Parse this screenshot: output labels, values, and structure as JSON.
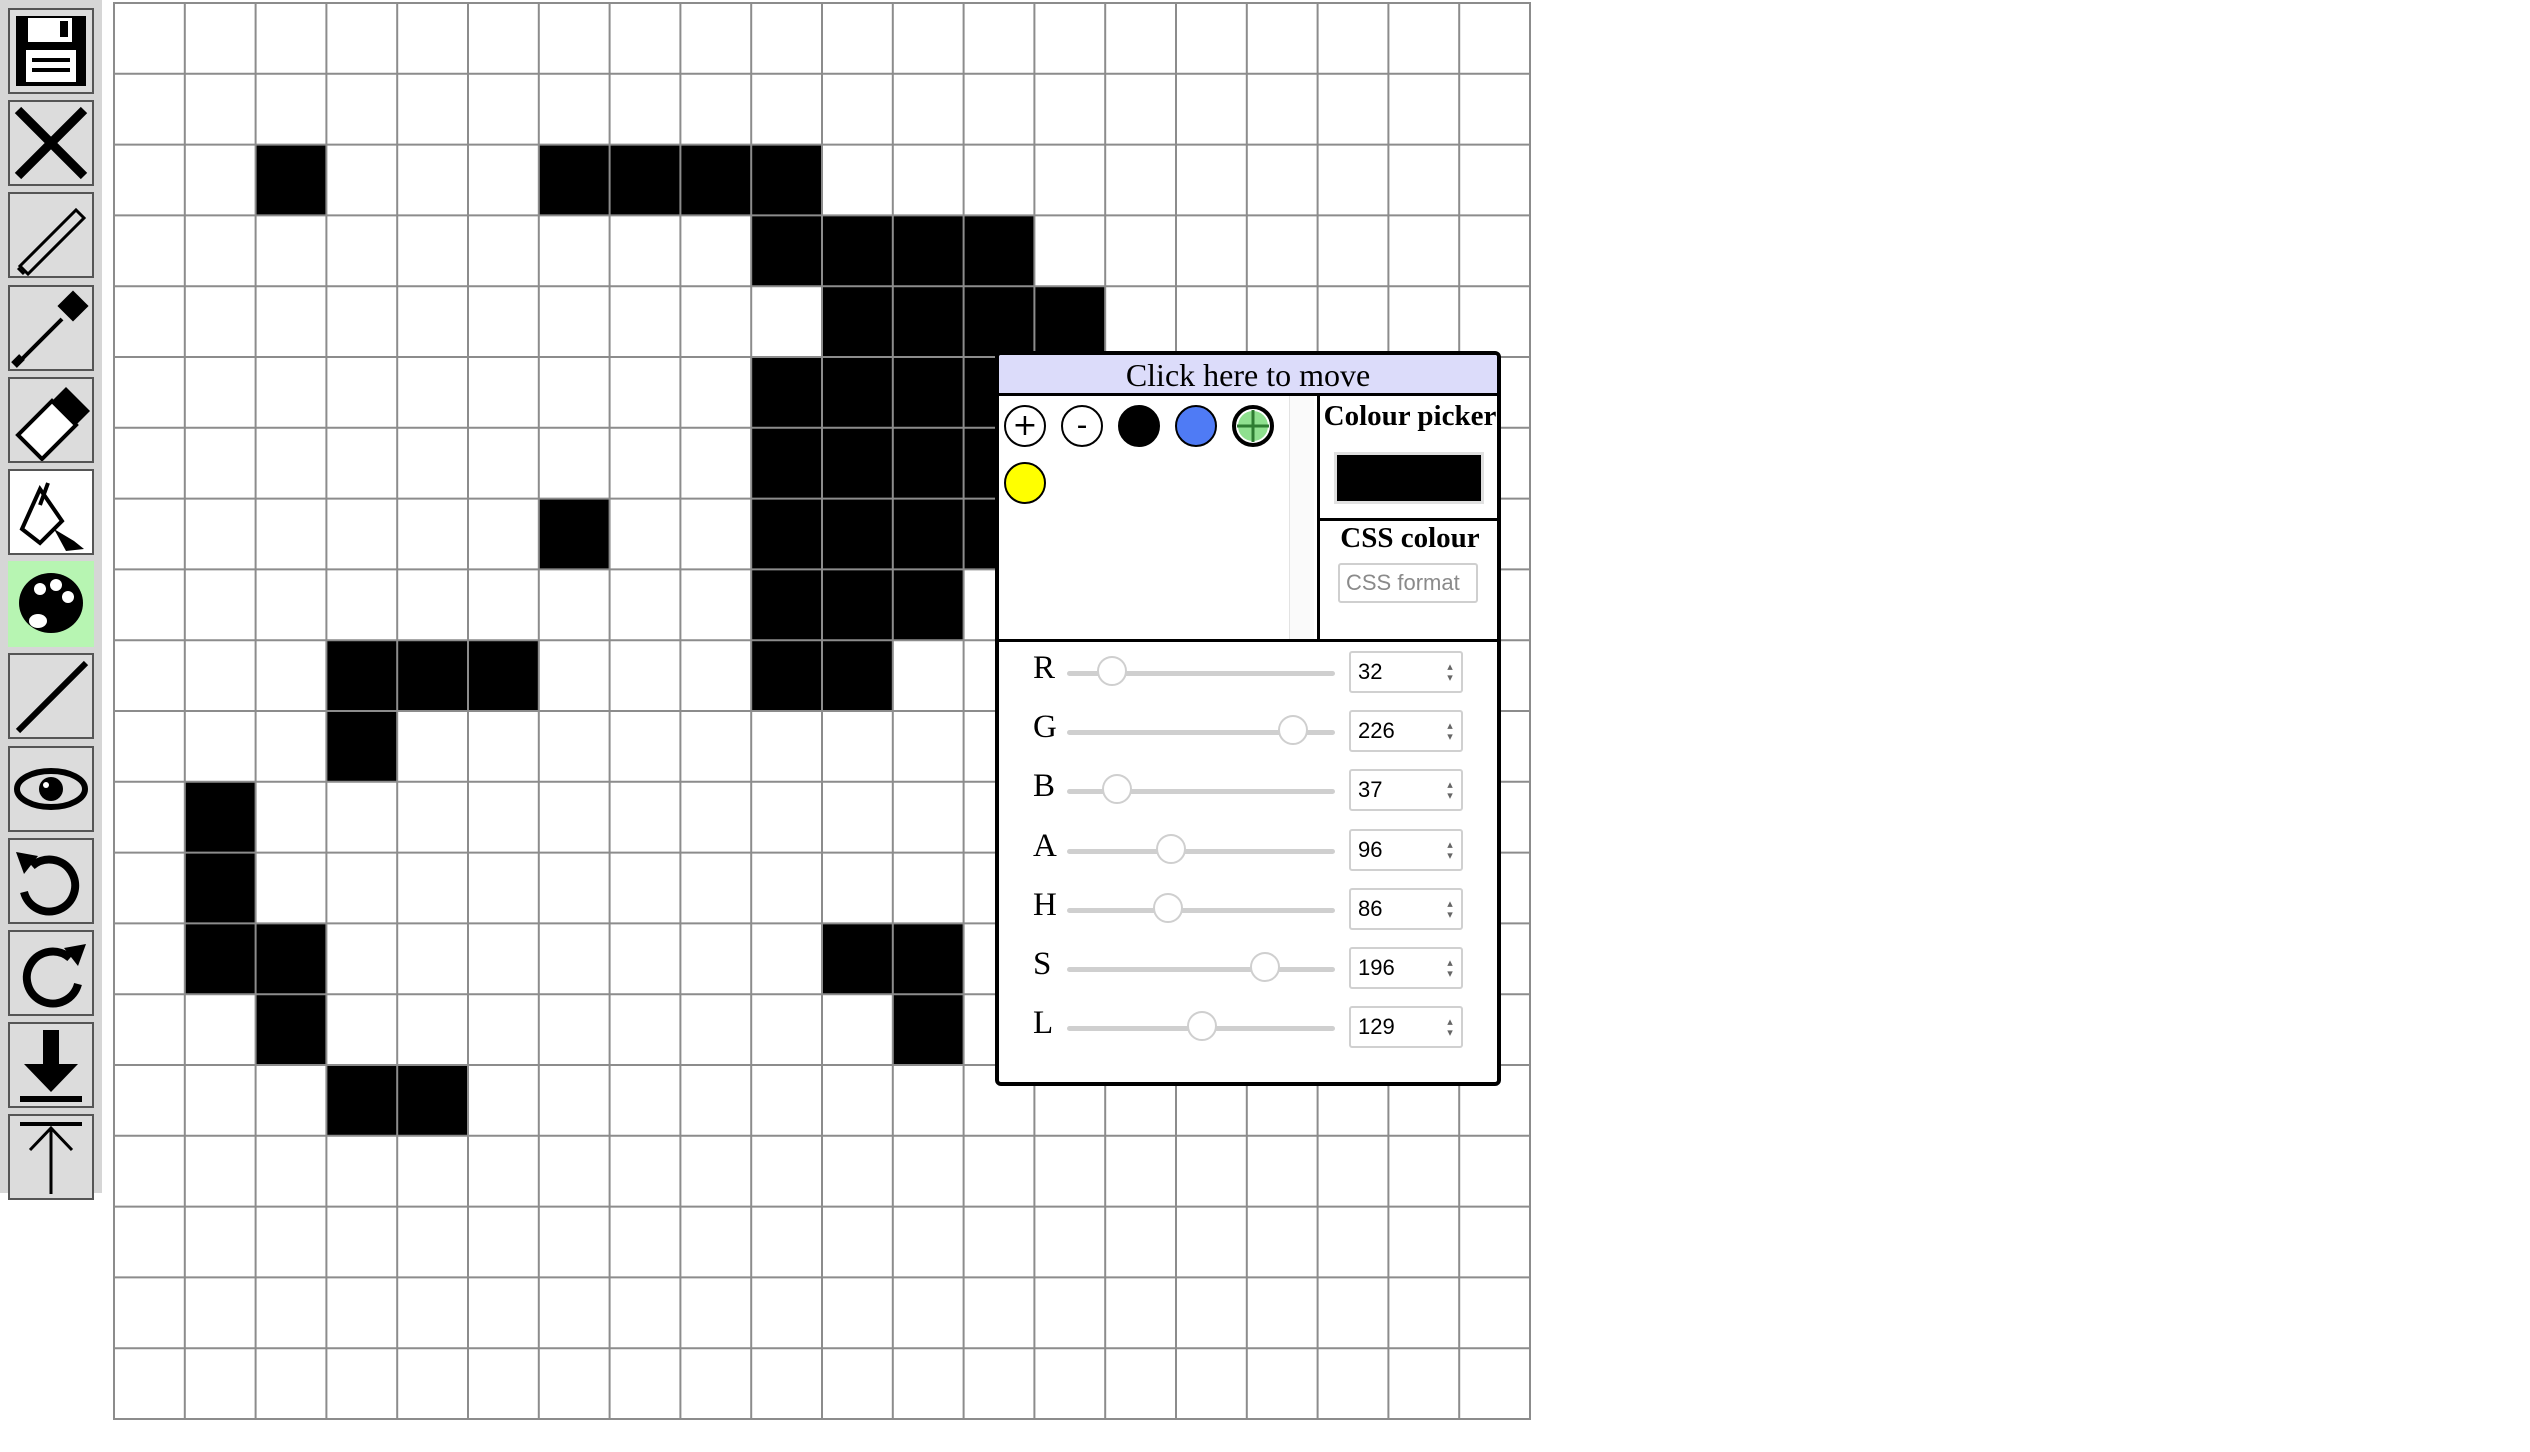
{
  "toolbar": {
    "tools": [
      {
        "name": "save-icon",
        "active": false
      },
      {
        "name": "clear-icon",
        "active": false
      },
      {
        "name": "pencil-icon",
        "active": false
      },
      {
        "name": "eyedropper-icon",
        "active": false
      },
      {
        "name": "eraser-icon",
        "active": false
      },
      {
        "name": "fill-bucket-icon",
        "active": false
      },
      {
        "name": "palette-icon",
        "active": true
      },
      {
        "name": "line-icon",
        "active": false
      },
      {
        "name": "preview-eye-icon",
        "active": false
      },
      {
        "name": "undo-icon",
        "active": false
      },
      {
        "name": "redo-icon",
        "active": false
      },
      {
        "name": "download-icon",
        "active": false
      },
      {
        "name": "upload-icon",
        "active": false
      }
    ]
  },
  "canvas": {
    "columns": 20,
    "rows": 20,
    "filled_cells": [
      [
        2,
        2
      ],
      [
        2,
        6
      ],
      [
        2,
        7
      ],
      [
        2,
        8
      ],
      [
        2,
        9
      ],
      [
        3,
        9
      ],
      [
        3,
        10
      ],
      [
        3,
        11
      ],
      [
        3,
        12
      ],
      [
        4,
        10
      ],
      [
        4,
        11
      ],
      [
        4,
        12
      ],
      [
        4,
        13
      ],
      [
        5,
        9
      ],
      [
        5,
        10
      ],
      [
        5,
        11
      ],
      [
        5,
        12
      ],
      [
        5,
        13
      ],
      [
        6,
        9
      ],
      [
        6,
        10
      ],
      [
        6,
        11
      ],
      [
        6,
        12
      ],
      [
        6,
        13
      ],
      [
        7,
        6
      ],
      [
        7,
        9
      ],
      [
        7,
        10
      ],
      [
        7,
        11
      ],
      [
        7,
        12
      ],
      [
        8,
        9
      ],
      [
        8,
        10
      ],
      [
        8,
        11
      ],
      [
        9,
        3
      ],
      [
        9,
        4
      ],
      [
        9,
        5
      ],
      [
        9,
        9
      ],
      [
        9,
        10
      ],
      [
        10,
        3
      ],
      [
        11,
        1
      ],
      [
        12,
        1
      ],
      [
        13,
        1
      ],
      [
        13,
        2
      ],
      [
        13,
        10
      ],
      [
        13,
        11
      ],
      [
        14,
        2
      ],
      [
        14,
        11
      ],
      [
        15,
        3
      ],
      [
        15,
        4
      ]
    ],
    "fill_color": "#000000"
  },
  "colour_panel": {
    "title": "Click here to move",
    "swatches": [
      {
        "kind": "add",
        "label": "+"
      },
      {
        "kind": "remove",
        "label": "-"
      },
      {
        "kind": "color",
        "color": "#000000"
      },
      {
        "kind": "color",
        "color": "#4f7bf5"
      },
      {
        "kind": "current",
        "color": "#8fe08f"
      },
      {
        "kind": "color",
        "color": "#ffff00"
      }
    ],
    "picker_label": "Colour picker",
    "picker_color": "#000000",
    "css_label": "CSS colour",
    "css_placeholder": "CSS format",
    "sliders": [
      {
        "label": "R",
        "value": "32",
        "fraction": 0.125
      },
      {
        "label": "G",
        "value": "226",
        "fraction": 0.886
      },
      {
        "label": "B",
        "value": "37",
        "fraction": 0.145
      },
      {
        "label": "A",
        "value": "96",
        "fraction": 0.376
      },
      {
        "label": "H",
        "value": "86",
        "fraction": 0.36
      },
      {
        "label": "S",
        "value": "196",
        "fraction": 0.77
      },
      {
        "label": "L",
        "value": "129",
        "fraction": 0.506
      }
    ]
  }
}
